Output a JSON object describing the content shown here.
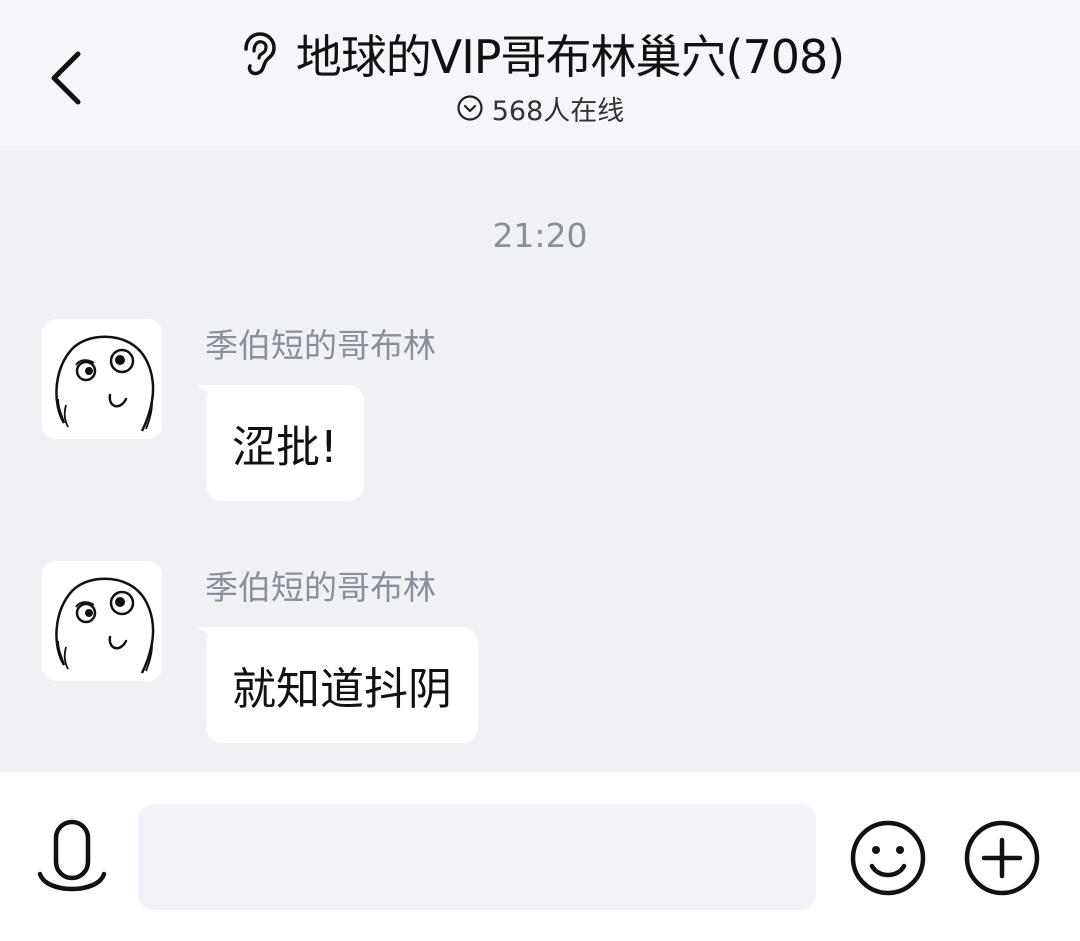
{
  "header": {
    "title": "地球的VIP哥布林巢穴(708)",
    "online": "568人在线",
    "back_icon": "chevron-left-icon",
    "ear_icon": "ear-icon"
  },
  "chat": {
    "timestamp": "21:20",
    "messages": [
      {
        "sender": "季伯短的哥布林",
        "text": "涩批!"
      },
      {
        "sender": "季伯短的哥布林",
        "text": "就知道抖阴"
      }
    ]
  },
  "input_bar": {
    "placeholder": "",
    "icons": [
      "microphone-icon",
      "emoji-icon",
      "plus-icon"
    ]
  },
  "colors": {
    "chat_background": "#f0f1f5",
    "header_background": "#f5f6fa",
    "bubble": "#ffffff",
    "muted_text": "#8a8f99"
  }
}
